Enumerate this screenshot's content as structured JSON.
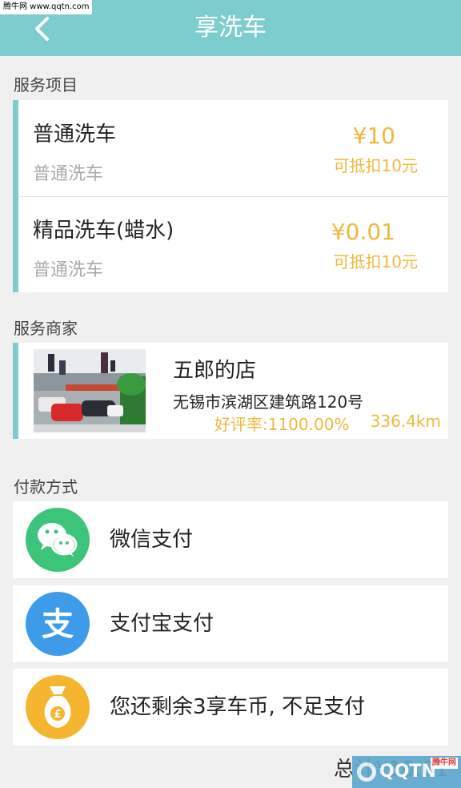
{
  "watermark_top": "腾牛网 www.qqtn.com",
  "header": {
    "title": "享洗车",
    "back_icon": "chevron-left-icon"
  },
  "sections": {
    "service_items": "服务项目",
    "service_merchant": "服务商家",
    "payment_method": "付款方式"
  },
  "services": [
    {
      "name": "普通洗车",
      "subtitle": "普通洗车",
      "price": "¥10",
      "deduct": "可抵扣10元"
    },
    {
      "name": "精品洗车(蜡水)",
      "subtitle": "普通洗车",
      "price": "¥0.01",
      "deduct": "可抵扣10元"
    }
  ],
  "merchant": {
    "name": "五郎的店",
    "address": "无锡市滨湖区建筑路120号",
    "rating": "好评率:1100.00%",
    "distance": "336.4km"
  },
  "payments": [
    {
      "label": "微信支付",
      "icon": "wechat-icon",
      "color": "#3cc47a"
    },
    {
      "label": "支付宝支付",
      "icon": "alipay-icon",
      "color": "#3d9be9"
    },
    {
      "label": "您还剩余3享车币, 不足支付",
      "icon": "money-bag-icon",
      "color": "#f5b52e"
    }
  ],
  "total": "总计¥10.01",
  "watermark_bottom": {
    "text": "QQTN",
    "badge": "腾牛网"
  },
  "colors": {
    "header": "#7ecdce",
    "accent": "#7ecdce",
    "price": "#f0b83c"
  }
}
